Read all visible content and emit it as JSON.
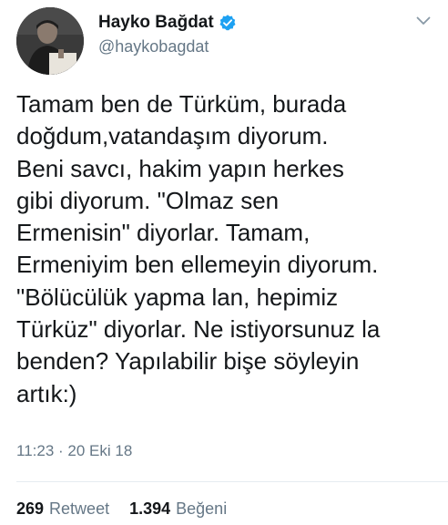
{
  "user": {
    "display_name": "Hayko Bağdat",
    "handle": "@haykobagdat",
    "verified_icon": "verified-badge-icon",
    "accent_color": "#1da1f2"
  },
  "tweet": {
    "text": "Tamam ben de Türküm, burada\ndoğdum,vatandaşım diyorum.\nBeni savcı, hakim yapın herkes\ngibi diyorum. \"Olmaz sen\nErmenisin\" diyorlar. Tamam,\nErmeniyim ben ellemeyin diyorum.\n\"Bölücülük yapma lan, hepimiz\nTürküz\" diyorlar. Ne istiyorsunuz la\nbenden? Yapılabilir bişe söyleyin\nartık:)",
    "timestamp": "11:23 · 20 Eki 18"
  },
  "stats": {
    "retweets_count": "269",
    "retweets_label": "Retweet",
    "likes_count": "1.394",
    "likes_label": "Beğeni"
  },
  "menu_icon": "chevron-down-icon"
}
